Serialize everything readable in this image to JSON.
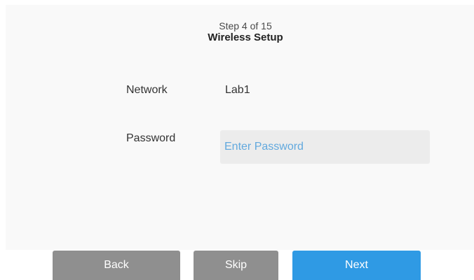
{
  "header": {
    "step": "Step 4 of 15",
    "title": "Wireless Setup"
  },
  "form": {
    "network_label": "Network",
    "network_value": "Lab1",
    "password_label": "Password",
    "password_placeholder": "Enter Password",
    "password_value": ""
  },
  "buttons": {
    "back": "Back",
    "skip": "Skip",
    "next": "Next"
  },
  "colors": {
    "primary_button": "#2f9ae4",
    "secondary_button": "#8f8f8f",
    "placeholder_text": "#62a9de"
  }
}
